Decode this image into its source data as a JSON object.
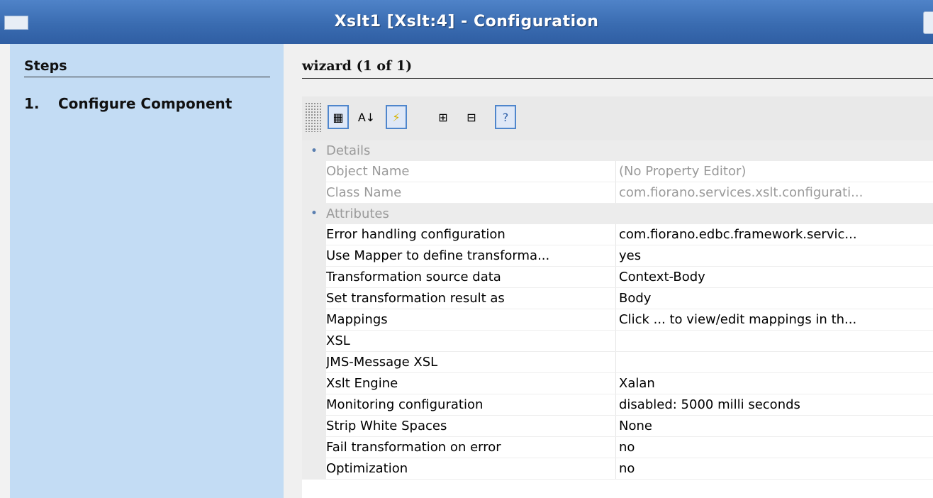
{
  "window": {
    "title": "Xslt1 [Xslt:4] - Configuration"
  },
  "sidebar": {
    "heading": "Steps",
    "step_number": "1.",
    "step_label": "Configure Component"
  },
  "main": {
    "wizard_title": "wizard (1 of 1)"
  },
  "toolbar": [
    {
      "icon": "categorized-icon",
      "glyph": "▦",
      "pressed": true
    },
    {
      "icon": "sort-alphabetical-icon",
      "glyph": "A↓",
      "pressed": false
    },
    {
      "icon": "lightning-icon",
      "glyph": "⚡",
      "pressed": true
    },
    {
      "icon": "collapse-all-icon",
      "glyph": "⊞",
      "pressed": false
    },
    {
      "icon": "expand-all-icon",
      "glyph": "⊟",
      "pressed": false
    },
    {
      "icon": "help-icon",
      "glyph": "?",
      "pressed": true
    }
  ],
  "categories": [
    {
      "label": "Details",
      "dim": true,
      "rows": [
        {
          "name": "Object Name",
          "value": "(No Property Editor)"
        },
        {
          "name": "Class Name",
          "value": "com.fiorano.services.xslt.configurati..."
        }
      ]
    },
    {
      "label": "Attributes",
      "dim": false,
      "rows": [
        {
          "name": "Error handling configuration",
          "value": "com.fiorano.edbc.framework.servic..."
        },
        {
          "name": "Use Mapper to define transforma...",
          "value": "yes"
        },
        {
          "name": "Transformation source data",
          "value": "Context-Body"
        },
        {
          "name": "Set transformation result as",
          "value": "Body"
        },
        {
          "name": "Mappings",
          "value": "Click ... to view/edit mappings in th..."
        },
        {
          "name": "XSL",
          "value": ""
        },
        {
          "name": "JMS-Message XSL",
          "value": ""
        },
        {
          "name": "Xslt Engine",
          "value": "Xalan"
        },
        {
          "name": "Monitoring configuration",
          "value": "disabled: 5000 milli seconds"
        },
        {
          "name": "Strip White Spaces",
          "value": "None"
        },
        {
          "name": "Fail transformation on error",
          "value": "no"
        },
        {
          "name": "Optimization",
          "value": "no"
        }
      ]
    }
  ]
}
